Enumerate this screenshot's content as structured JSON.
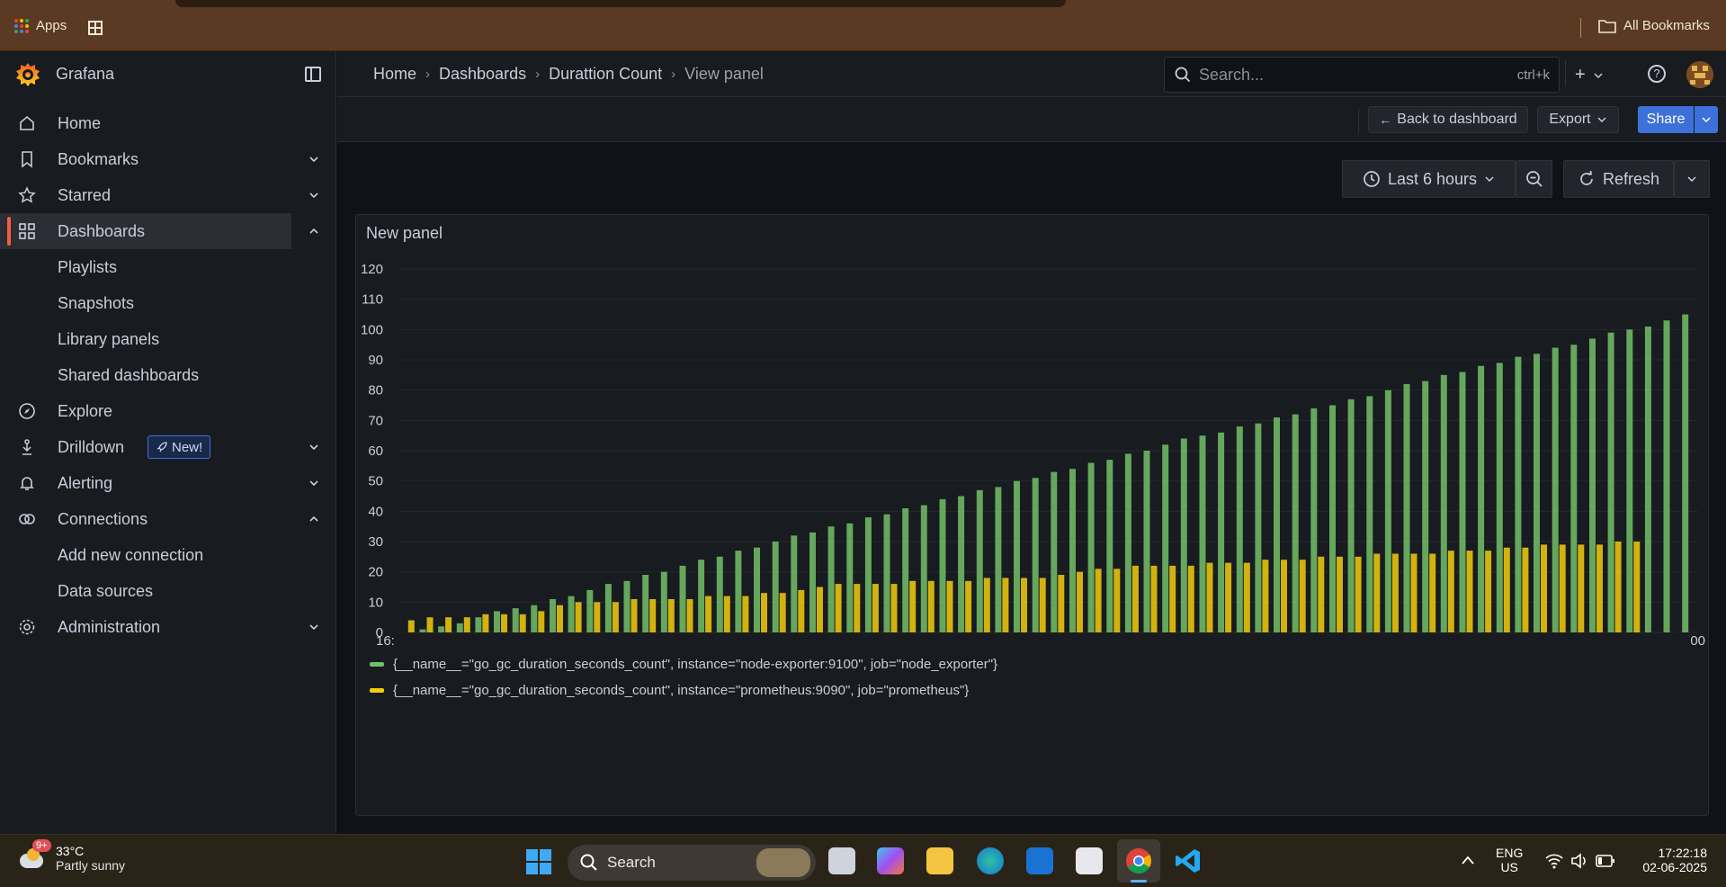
{
  "browser": {
    "apps_label": "Apps",
    "all_bookmarks_label": "All Bookmarks"
  },
  "sidebar": {
    "brand": "Grafana",
    "items": [
      {
        "label": "Home",
        "icon": "home-icon"
      },
      {
        "label": "Bookmarks",
        "icon": "bookmark-icon"
      },
      {
        "label": "Starred",
        "icon": "star-icon"
      },
      {
        "label": "Dashboards",
        "icon": "apps-icon"
      },
      {
        "label": "Explore",
        "icon": "compass-icon"
      },
      {
        "label": "Drilldown",
        "icon": "drilldown-icon"
      },
      {
        "label": "Alerting",
        "icon": "bell-icon"
      },
      {
        "label": "Connections",
        "icon": "connections-icon"
      },
      {
        "label": "Administration",
        "icon": "gear-icon"
      }
    ],
    "dashboards_children": [
      "Playlists",
      "Snapshots",
      "Library panels",
      "Shared dashboards"
    ],
    "connections_children": [
      "Add new connection",
      "Data sources"
    ],
    "new_badge": "New!"
  },
  "header": {
    "breadcrumbs": [
      "Home",
      "Dashboards",
      "Durattion Count",
      "View panel"
    ],
    "search_placeholder": "Search...",
    "search_shortcut": "ctrl+k",
    "plus_label": "+",
    "help_label": "?"
  },
  "toolbar": {
    "back_label": "Back to dashboard",
    "export_label": "Export",
    "share_label": "Share"
  },
  "controls": {
    "time_range": "Last 6 hours",
    "refresh_label": "Refresh"
  },
  "panel": {
    "title": "New panel"
  },
  "chart_data": {
    "type": "bar",
    "y_ticks": [
      0,
      10,
      20,
      30,
      40,
      50,
      60,
      70,
      80,
      90,
      100,
      110,
      120
    ],
    "ylim": [
      0,
      120
    ],
    "x_first_label": "16:",
    "x_last_label": "00",
    "grid": true,
    "legend_placement": "bottom",
    "series": [
      {
        "name": "{__name__=\"go_gc_duration_seconds_count\", instance=\"node-exporter:9100\", job=\"node_exporter\"}",
        "color": "#73bf69",
        "values": [
          0,
          1,
          2,
          3,
          5,
          7,
          8,
          9,
          11,
          12,
          14,
          16,
          17,
          19,
          20,
          22,
          24,
          25,
          27,
          28,
          30,
          32,
          33,
          35,
          36,
          38,
          39,
          41,
          42,
          44,
          45,
          47,
          48,
          50,
          51,
          53,
          54,
          56,
          57,
          59,
          60,
          62,
          64,
          65,
          66,
          68,
          69,
          71,
          72,
          74,
          75,
          77,
          78,
          80,
          82,
          83,
          85,
          86,
          88,
          89,
          91,
          92,
          94,
          95,
          97,
          99,
          100,
          101,
          103,
          105
        ]
      },
      {
        "name": "{__name__=\"go_gc_duration_seconds_count\", instance=\"prometheus:9090\", job=\"prometheus\"}",
        "color": "#f2cc0c",
        "values": [
          4,
          5,
          5,
          5,
          6,
          6,
          6,
          7,
          9,
          10,
          10,
          10,
          11,
          11,
          11,
          11,
          12,
          12,
          12,
          13,
          13,
          14,
          15,
          16,
          16,
          16,
          16,
          17,
          17,
          17,
          17,
          18,
          18,
          18,
          18,
          19,
          20,
          21,
          21,
          22,
          22,
          22,
          22,
          23,
          23,
          23,
          24,
          24,
          24,
          25,
          25,
          25,
          26,
          26,
          26,
          26,
          27,
          27,
          27,
          28,
          28,
          29,
          29,
          29,
          29,
          30,
          30
        ]
      }
    ]
  },
  "taskbar": {
    "temperature": "33°C",
    "weather_desc": "Partly sunny",
    "weather_badge": "9+",
    "search_label": "Search",
    "lang_1": "ENG",
    "lang_2": "US",
    "time": "17:22:18",
    "date": "02-06-2025"
  }
}
